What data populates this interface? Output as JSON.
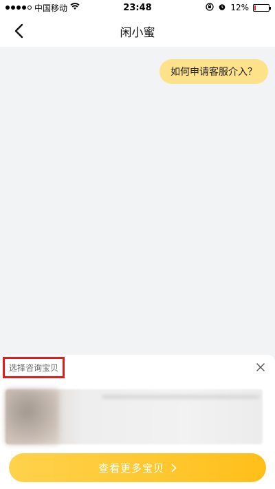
{
  "status_bar": {
    "carrier": "中国移动",
    "time": "23:48",
    "battery_percent": "12%",
    "battery_level": 0.12
  },
  "nav": {
    "title": "闲小蜜",
    "back_icon": "chevron-left-icon"
  },
  "chat": {
    "messages": [
      {
        "from": "user",
        "text": "如何申请客服介入？"
      }
    ]
  },
  "sheet": {
    "title": "选择咨询宝贝",
    "close_icon": "close-icon"
  },
  "footer": {
    "more_button_label": "查看更多宝贝",
    "more_button_icon": "chevron-right-icon",
    "accent": "#ffc61f"
  }
}
